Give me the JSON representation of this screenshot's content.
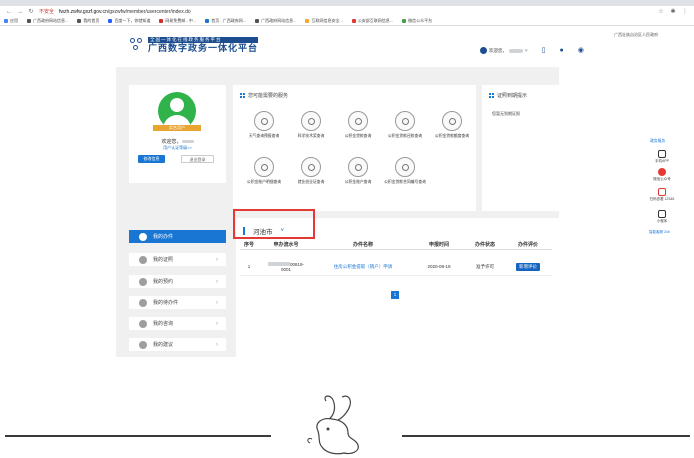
{
  "browser": {
    "url_warning": "不安全",
    "url_host": "fwzh.zwfw.gxzf.gov.cn",
    "url_path": "/gxzwfw/member/usercenter/index.do",
    "bookmarks": [
      "应用",
      "广西政府网站信息...",
      "我的首页",
      "百度一下，你就知道",
      "网易免费邮 - 中...",
      "首页 - 广西政府网...",
      "广西政府网站信息...",
      "互联网信息安全...",
      "公安部互联网信息...",
      "微信公众平台"
    ]
  },
  "header": {
    "logo_sub": "全国一体化在线政务服务平台",
    "logo_main": "广西数字政务一体化平台",
    "region": "广西壮族自治区人民政府",
    "welcome": "欢迎您，"
  },
  "profile": {
    "badge": "实名用户",
    "welcome": "欢迎您，",
    "level": "用户认证等级>>",
    "edit_button": "修改信息",
    "logout_button": "退出登录"
  },
  "services": {
    "title": "您可能需要的服务",
    "items": [
      "天气查询预报查询",
      "科学技术奖查询",
      "公积金贷款查询",
      "公积金贷款还款查询",
      "公积金贷款额度查询",
      "公积金账户明细查询",
      "就业创业证查询",
      "公积金账户查询",
      "公积金贷款合同编号查询"
    ]
  },
  "reminder": {
    "title": "证照到期提示",
    "text": "您暂无到期证照"
  },
  "menu": {
    "items": [
      "我的办件",
      "我的证照",
      "我的预约",
      "我的待办件",
      "我的咨询",
      "我的建议"
    ]
  },
  "tasks": {
    "city": "河池市",
    "headers": [
      "序号",
      "申办流水号",
      "办件名称",
      "申报时间",
      "办件状态",
      "办件评价"
    ],
    "rows": [
      {
        "index": "1",
        "serial_tail": "00819-",
        "serial_line2": "0001",
        "name": "住房公积金提取（销户）申请",
        "date": "2020-08-19",
        "status": "准予许可",
        "action": "新增评价"
      }
    ],
    "page": "1"
  },
  "floatbar": {
    "title": "政务服务",
    "items": [
      "手机APP",
      "微信公众号",
      "扫码查看 12345",
      "小程序"
    ],
    "footer": "智能客服 24h"
  },
  "icons": {
    "back": "back-arrow-icon",
    "forward": "forward-arrow-icon",
    "reload": "reload-icon",
    "star": "star-icon"
  },
  "colors": {
    "brand_blue": "#1976d2",
    "highlight_red": "#e53935",
    "avatar_green": "#2fb34a",
    "badge_orange": "#e8a531"
  }
}
